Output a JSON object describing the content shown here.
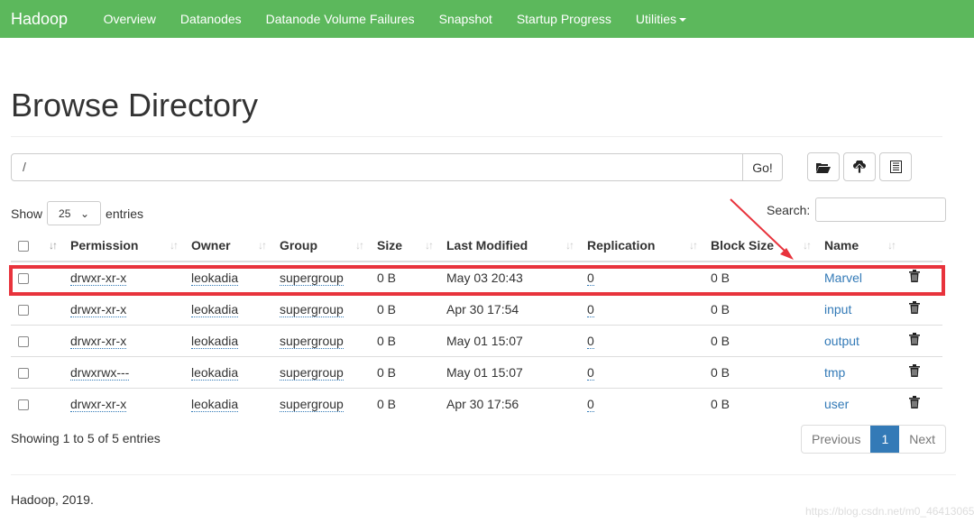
{
  "nav": {
    "brand": "Hadoop",
    "items": [
      "Overview",
      "Datanodes",
      "Datanode Volume Failures",
      "Snapshot",
      "Startup Progress",
      "Utilities"
    ]
  },
  "title": "Browse Directory",
  "path": {
    "value": "/",
    "go": "Go!"
  },
  "toolbar": {
    "icons": [
      "folder-open-icon",
      "cloud-upload-icon",
      "list-alt-icon"
    ]
  },
  "show": {
    "label_before": "Show",
    "value": "25",
    "label_after": "entries"
  },
  "search": {
    "label": "Search:",
    "value": ""
  },
  "columns": [
    "Permission",
    "Owner",
    "Group",
    "Size",
    "Last Modified",
    "Replication",
    "Block Size",
    "Name"
  ],
  "rows": [
    {
      "permission": "drwxr-xr-x",
      "owner": "leokadia",
      "group": "supergroup",
      "size": "0 B",
      "modified": "May 03 20:43",
      "replication": "0",
      "block": "0 B",
      "name": "Marvel"
    },
    {
      "permission": "drwxr-xr-x",
      "owner": "leokadia",
      "group": "supergroup",
      "size": "0 B",
      "modified": "Apr 30 17:54",
      "replication": "0",
      "block": "0 B",
      "name": "input"
    },
    {
      "permission": "drwxr-xr-x",
      "owner": "leokadia",
      "group": "supergroup",
      "size": "0 B",
      "modified": "May 01 15:07",
      "replication": "0",
      "block": "0 B",
      "name": "output"
    },
    {
      "permission": "drwxrwx---",
      "owner": "leokadia",
      "group": "supergroup",
      "size": "0 B",
      "modified": "May 01 15:07",
      "replication": "0",
      "block": "0 B",
      "name": "tmp"
    },
    {
      "permission": "drwxr-xr-x",
      "owner": "leokadia",
      "group": "supergroup",
      "size": "0 B",
      "modified": "Apr 30 17:56",
      "replication": "0",
      "block": "0 B",
      "name": "user"
    }
  ],
  "info": "Showing 1 to 5 of 5 entries",
  "pager": {
    "prev": "Previous",
    "page": "1",
    "next": "Next"
  },
  "footer": "Hadoop, 2019.",
  "watermark": "https://blog.csdn.net/m0_46413065",
  "colors": {
    "navbar": "#5cb85c",
    "link": "#337ab7",
    "highlight": "#e8333c"
  }
}
